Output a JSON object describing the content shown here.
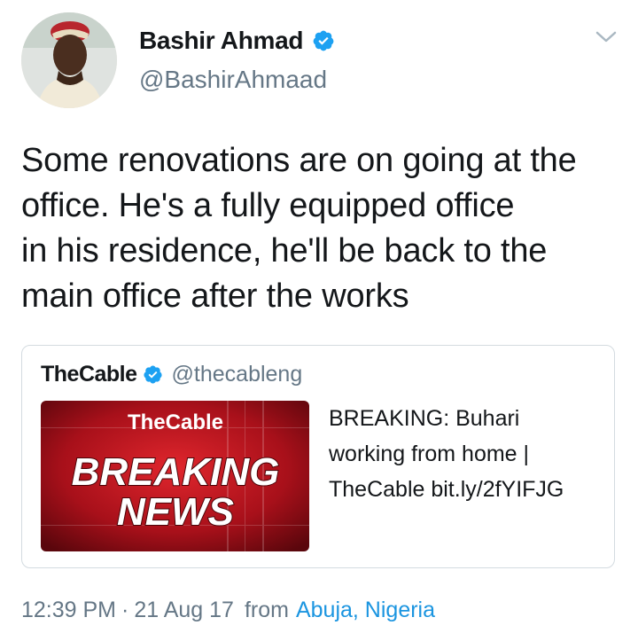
{
  "tweet": {
    "author": {
      "display_name": "Bashir Ahmad",
      "handle": "@BashirAhmaad",
      "verified": true
    },
    "text_lines": [
      "Some renovations are on going at the",
      "office. He's a fully equipped office",
      "in his residence, he'll be back to the",
      "main office after the works"
    ],
    "quoted": {
      "display_name": "TheCable",
      "handle": "@thecableng",
      "verified": true,
      "image": {
        "brand": "TheCable",
        "headline_line1": "BREAKING",
        "headline_line2": "NEWS"
      },
      "text_lines": [
        "BREAKING: Buhari",
        "working from home |",
        "TheCable bit.ly/2fYIFJG"
      ]
    },
    "meta": {
      "time": "12:39 PM",
      "separator": "·",
      "date": "21 Aug 17",
      "from_label": "from",
      "location": "Abuja, Nigeria"
    }
  },
  "colors": {
    "link_blue": "#1b95e0",
    "secondary_text": "#657786",
    "verified_blue": "#1da1f2",
    "breaking_red": "#b8141a"
  },
  "icons": [
    "verified-badge-icon",
    "chevron-down-icon"
  ]
}
